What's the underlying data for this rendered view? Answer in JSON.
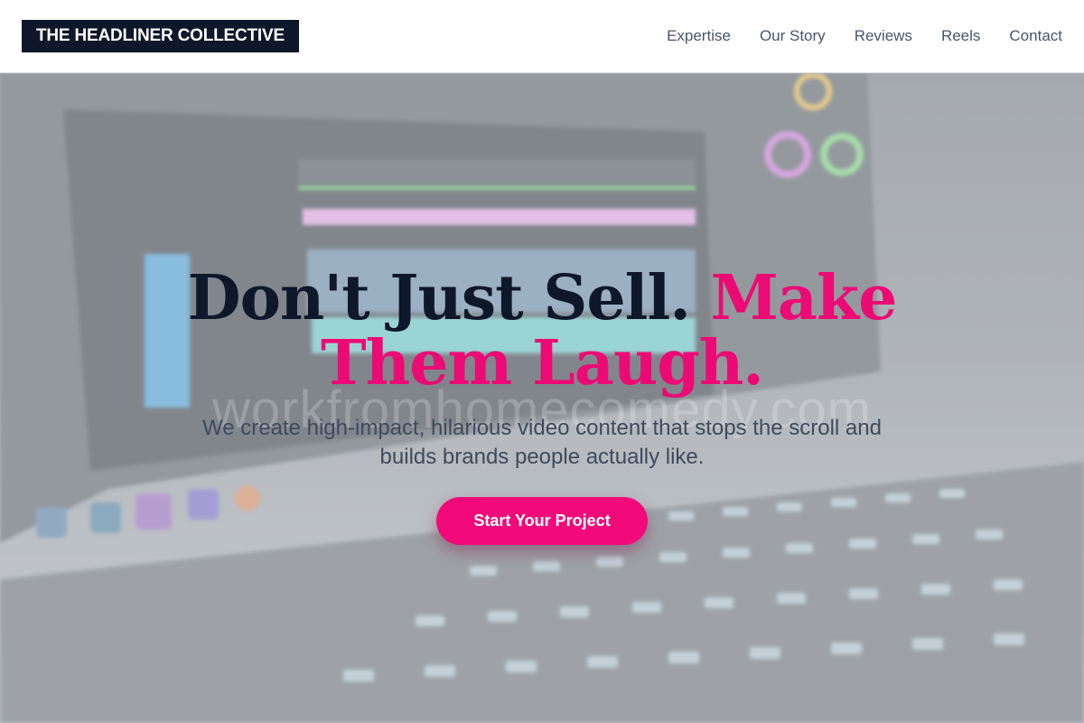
{
  "header": {
    "logo": "THE HEADLINER COLLECTIVE",
    "nav": [
      {
        "label": "Expertise"
      },
      {
        "label": "Our Story"
      },
      {
        "label": "Reviews"
      },
      {
        "label": "Reels"
      },
      {
        "label": "Contact"
      }
    ]
  },
  "hero": {
    "headline_part1": "Don't Just Sell.",
    "headline_part2": "Make Them Laugh.",
    "subheadline": "We create high-impact, hilarious video content that stops the scroll and builds brands people actually like.",
    "cta_label": "Start Your Project",
    "watermark": "workfromhomecomedy.com",
    "background_image": "blurred laptop with video editing timeline and backlit keyboard"
  },
  "colors": {
    "accent": "#ec0a75",
    "headline": "#0f172a",
    "logo_bg": "#0f172a",
    "nav_text": "#475569"
  }
}
